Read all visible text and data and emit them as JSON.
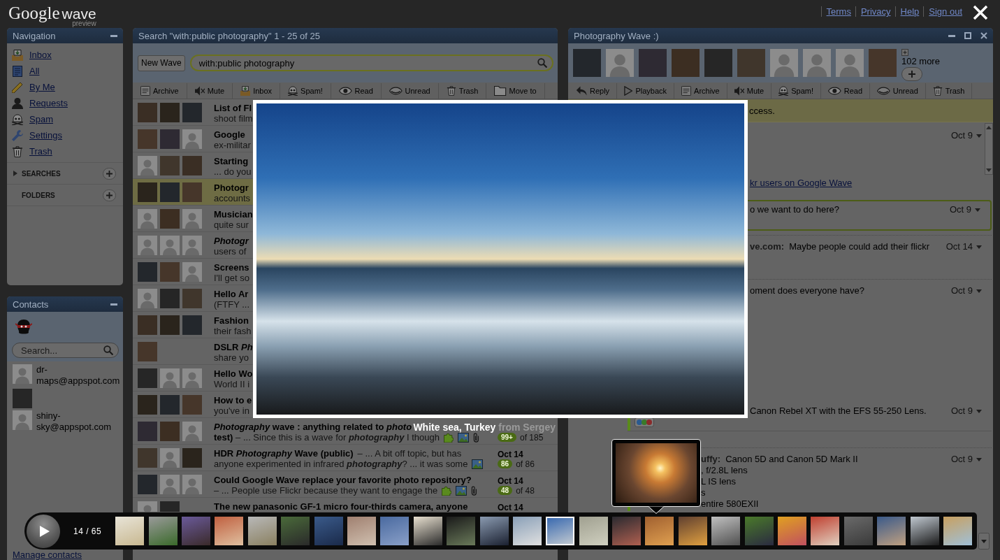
{
  "topbar": {
    "logo": {
      "brand": "Google",
      "product": "wave",
      "tag": "preview"
    },
    "links": [
      "Terms",
      "Privacy",
      "Help",
      "Sign out"
    ]
  },
  "navigation": {
    "title": "Navigation",
    "items": [
      {
        "kind": "inbox",
        "label": "Inbox"
      },
      {
        "kind": "all",
        "label": "All"
      },
      {
        "kind": "byme",
        "label": "By Me"
      },
      {
        "kind": "requests",
        "label": "Requests"
      },
      {
        "kind": "spam",
        "label": "Spam"
      },
      {
        "kind": "settings",
        "label": "Settings"
      },
      {
        "kind": "trash",
        "label": "Trash"
      }
    ],
    "sections": [
      {
        "kind": "toggle",
        "label": "SEARCHES"
      },
      {
        "kind": "plain",
        "label": "FOLDERS"
      }
    ]
  },
  "contacts": {
    "title": "Contacts",
    "search": {
      "placeholder": "Search..."
    },
    "people": [
      {
        "avatar": {
          "kind": "silhouette"
        },
        "name": "dr-maps@appspot.com"
      },
      {
        "avatar": {
          "kind": "picture"
        }
      },
      {
        "avatar": {
          "kind": "silhouette"
        },
        "name": "shiny-sky@appspot.com"
      }
    ],
    "manage_link": "Manage contacts"
  },
  "search_panel": {
    "title": "Search \"with:public photography\" 1 - 25 of 25",
    "new_wave": "New Wave",
    "query": "with:public photography",
    "toolbar": [
      {
        "kind": "archive",
        "label": "Archive"
      },
      {
        "kind": "mute",
        "label": "Mute"
      },
      {
        "kind": "inbox",
        "label": "Inbox"
      },
      {
        "kind": "spam",
        "label": "Spam!"
      },
      {
        "kind": "read",
        "label": "Read"
      },
      {
        "kind": "unread",
        "label": "Unread"
      },
      {
        "kind": "trash",
        "label": "Trash"
      },
      {
        "kind": "folder",
        "label": "Move to"
      }
    ],
    "waves": [
      {
        "avatars": [
          {
            "kind": "picture"
          },
          {
            "kind": "picture"
          },
          {
            "kind": "picture"
          }
        ],
        "title": "List of Fl",
        "snippet": "shoot film",
        "selected": false
      },
      {
        "avatars": [
          {
            "kind": "picture"
          },
          {
            "kind": "picture"
          },
          {
            "kind": "silhouette"
          }
        ],
        "title": "Google",
        "snippet": "ex-militar",
        "selected": false
      },
      {
        "avatars": [
          {
            "kind": "silhouette"
          },
          {
            "kind": "picture"
          },
          {
            "kind": "picture"
          }
        ],
        "title": "Starting",
        "snippet": "... do you",
        "selected": false
      },
      {
        "avatars": [
          {
            "kind": "picture"
          },
          {
            "kind": "picture"
          },
          {
            "kind": "picture"
          }
        ],
        "title": "Photogr",
        "snippet": "accounts",
        "selected": true
      },
      {
        "avatars": [
          {
            "kind": "silhouette"
          },
          {
            "kind": "picture"
          },
          {
            "kind": "silhouette"
          }
        ],
        "title": "Musician",
        "snippet": "quite sur",
        "selected": false
      },
      {
        "avatars": [
          {
            "kind": "silhouette"
          },
          {
            "kind": "silhouette"
          },
          {
            "kind": "silhouette"
          }
        ],
        "title": "*Photogr*",
        "snippet": "users of",
        "selected": false
      },
      {
        "avatars": [
          {
            "kind": "picture"
          },
          {
            "kind": "picture"
          },
          {
            "kind": "silhouette"
          }
        ],
        "title": "Screens",
        "snippet": "I'll get so",
        "selected": false
      },
      {
        "avatars": [
          {
            "kind": "silhouette"
          },
          {
            "kind": "picture"
          },
          {
            "kind": "picture"
          }
        ],
        "title": "Hello Ar",
        "snippet": "(FTFY ...",
        "selected": false
      },
      {
        "avatars": [
          {
            "kind": "picture"
          },
          {
            "kind": "picture"
          },
          {
            "kind": "picture"
          }
        ],
        "title": "Fashion",
        "snippet": "their fash",
        "selected": false
      },
      {
        "avatars": [
          {
            "kind": "picture"
          }
        ],
        "title": "DSLR *Ph*",
        "snippet": "share yo",
        "selected": false
      },
      {
        "avatars": [
          {
            "kind": "picture"
          },
          {
            "kind": "silhouette"
          },
          {
            "kind": "silhouette"
          }
        ],
        "title": "Hello Wo",
        "snippet": "World II i",
        "selected": false
      },
      {
        "avatars": [
          {
            "kind": "picture"
          },
          {
            "kind": "picture"
          },
          {
            "kind": "picture"
          }
        ],
        "title": "How to e",
        "snippet": "you've in",
        "selected": false
      },
      {
        "avatars": [
          {
            "kind": "picture"
          },
          {
            "kind": "picture"
          },
          {
            "kind": "silhouette"
          }
        ],
        "title": "*Photography* wave : anything related to *photo*",
        "snippet": "**test)** – ... Since this is a wave for *photography* I though",
        "attachments": [
          {
            "kind": "gadget"
          },
          {
            "kind": "image"
          },
          {
            "kind": "attachment"
          }
        ],
        "unread_count": "99+",
        "message_count": "of 185",
        "selected": false
      },
      {
        "avatars": [
          {
            "kind": "picture"
          },
          {
            "kind": "silhouette"
          },
          {
            "kind": "picture"
          }
        ],
        "title": "HDR *Photography* Wave (public)",
        "excerpt": "– ... A bit off topic, but has",
        "snippet": "anyone experimented in infrared *photography*? ... it was some",
        "attachments": [
          {
            "kind": "image"
          }
        ],
        "date": "Oct 14",
        "unread_count": "86",
        "message_count": "of 86",
        "selected": false
      },
      {
        "avatars": [
          {
            "kind": "picture"
          },
          {
            "kind": "silhouette"
          },
          {
            "kind": "silhouette"
          }
        ],
        "title": "Could Google Wave replace your favorite photo repository?",
        "snippet": "– ... People use Flickr because they want to engage the",
        "attachments": [
          {
            "kind": "gadget"
          },
          {
            "kind": "image"
          },
          {
            "kind": "attachment"
          }
        ],
        "date": "Oct 14",
        "unread_count": "48",
        "message_count": "of 48",
        "selected": false
      },
      {
        "avatars": [
          {
            "kind": "silhouette"
          },
          {
            "kind": "picture"
          }
        ],
        "title": "The new panasonic GF-1 micro four-thirds camera, anyone",
        "date": "Oct 14",
        "selected": false
      }
    ]
  },
  "wave_panel": {
    "title": "Photography Wave :)",
    "participants": [
      {
        "kind": "picture"
      },
      {
        "kind": "silhouette"
      },
      {
        "kind": "picture"
      },
      {
        "kind": "picture"
      },
      {
        "kind": "picture"
      },
      {
        "kind": "picture"
      },
      {
        "kind": "silhouette"
      },
      {
        "kind": "silhouette"
      },
      {
        "kind": "silhouette"
      },
      {
        "kind": "picture"
      }
    ],
    "more": "102 more",
    "toolbar": [
      {
        "kind": "reply",
        "label": "Reply"
      },
      {
        "kind": "playback",
        "label": "Playback"
      },
      {
        "kind": "archive",
        "label": "Archive"
      },
      {
        "kind": "mute",
        "label": "Mute"
      },
      {
        "kind": "spam",
        "label": "Spam!"
      },
      {
        "kind": "read",
        "label": "Read"
      },
      {
        "kind": "unread",
        "label": "Unread"
      },
      {
        "kind": "trash",
        "label": "Trash"
      }
    ],
    "notice": "ccess.",
    "blips": [
      {
        "date": "Oct 9",
        "link": "kr users on Google Wave",
        "focused": false
      },
      {
        "text": "o we want to do here?",
        "date": "Oct 9",
        "focused": true
      },
      {
        "author": "ve.com:",
        "text": "Maybe people could add their flickr",
        "date": "Oct 14",
        "focused": false
      },
      {
        "text": "oment does everyone have?",
        "date": "Oct 9",
        "focused": false
      },
      {
        "text": "Canon Rebel XT with the EFS 55-250 Lens.",
        "date": "Oct 9",
        "focused": false,
        "unread": true,
        "attachments": [
          {
            "kind": "image"
          }
        ]
      },
      {
        "author": "uffy:",
        "text": "Canon 5D and Canon 5D Mark II",
        "date": "Oct 9",
        "focused": false,
        "unread": true,
        "lines": [
          ", f/2.8L lens",
          "L IS lens",
          "s",
          "entire 580EXII"
        ]
      }
    ]
  },
  "lightbox": {
    "caption": {
      "title": "White sea, Turkey",
      "credit": "from Sergey"
    },
    "counter": "14 / 65",
    "thumbnails": [
      {
        "selected": false,
        "hovered": false
      },
      {
        "selected": false,
        "hovered": false
      },
      {
        "selected": false,
        "hovered": false
      },
      {
        "selected": false,
        "hovered": false
      },
      {
        "selected": false,
        "hovered": false
      },
      {
        "selected": false,
        "hovered": false
      },
      {
        "selected": false,
        "hovered": false
      },
      {
        "selected": false,
        "hovered": false
      },
      {
        "selected": false,
        "hovered": false
      },
      {
        "selected": false,
        "hovered": false
      },
      {
        "selected": false,
        "hovered": false
      },
      {
        "selected": false,
        "hovered": false
      },
      {
        "selected": false,
        "hovered": false
      },
      {
        "selected": true,
        "hovered": false
      },
      {
        "selected": false,
        "hovered": false
      },
      {
        "selected": false,
        "hovered": false
      },
      {
        "selected": false,
        "hovered": true
      },
      {
        "selected": false,
        "hovered": false
      },
      {
        "selected": false,
        "hovered": false
      },
      {
        "selected": false,
        "hovered": false
      },
      {
        "selected": false,
        "hovered": false
      },
      {
        "selected": false,
        "hovered": false
      },
      {
        "selected": false,
        "hovered": false
      },
      {
        "selected": false,
        "hovered": false
      },
      {
        "selected": false,
        "hovered": false
      },
      {
        "selected": false,
        "hovered": false
      }
    ]
  }
}
